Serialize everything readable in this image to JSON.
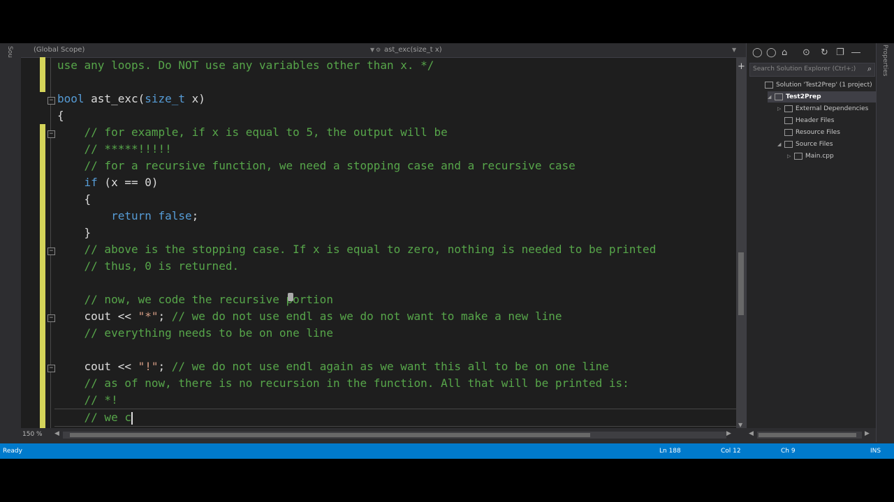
{
  "left_strip": {
    "tab_label": "Sou"
  },
  "navbar": {
    "scope": "(Global Scope)",
    "member": "ast_exc(size_t x)"
  },
  "code_lines": [
    [
      [
        "cm",
        "use any loops. Do NOT use any variables other than x. */"
      ]
    ],
    [],
    [
      [
        "kw",
        "bool"
      ],
      [
        "txt",
        " ast_exc("
      ],
      [
        "kw",
        "size_t"
      ],
      [
        "txt",
        " x)"
      ]
    ],
    [
      [
        "txt",
        "{"
      ]
    ],
    [
      [
        "txt",
        "    "
      ],
      [
        "cm",
        "// for example, if x is equal to 5, the output will be"
      ]
    ],
    [
      [
        "txt",
        "    "
      ],
      [
        "cm",
        "// *****!!!!!"
      ]
    ],
    [
      [
        "txt",
        "    "
      ],
      [
        "cm",
        "// for a recursive function, we need a stopping case and a recursive case"
      ]
    ],
    [
      [
        "txt",
        "    "
      ],
      [
        "kw",
        "if"
      ],
      [
        "txt",
        " (x == 0)"
      ]
    ],
    [
      [
        "txt",
        "    {"
      ]
    ],
    [
      [
        "txt",
        "        "
      ],
      [
        "kw",
        "return"
      ],
      [
        "txt",
        " "
      ],
      [
        "kw",
        "false"
      ],
      [
        "txt",
        ";"
      ]
    ],
    [
      [
        "txt",
        "    }"
      ]
    ],
    [
      [
        "txt",
        "    "
      ],
      [
        "cm",
        "// above is the stopping case. If x is equal to zero, nothing is needed to be printed"
      ]
    ],
    [
      [
        "txt",
        "    "
      ],
      [
        "cm",
        "// thus, 0 is returned."
      ]
    ],
    [],
    [
      [
        "txt",
        "    "
      ],
      [
        "cm",
        "// now, we code the recursive portion"
      ]
    ],
    [
      [
        "txt",
        "    cout << "
      ],
      [
        "str",
        "\"*\""
      ],
      [
        "txt",
        "; "
      ],
      [
        "cm",
        "// we do not use endl as we do not want to make a new line"
      ]
    ],
    [
      [
        "txt",
        "    "
      ],
      [
        "cm",
        "// everything needs to be on one line"
      ]
    ],
    [],
    [
      [
        "txt",
        "    cout << "
      ],
      [
        "str",
        "\"!\""
      ],
      [
        "txt",
        "; "
      ],
      [
        "cm",
        "// we do not use endl again as we want this all to be on one line"
      ]
    ],
    [
      [
        "txt",
        "    "
      ],
      [
        "cm",
        "// as of now, there is no recursion in the function. All that will be printed is:"
      ]
    ],
    [
      [
        "txt",
        "    "
      ],
      [
        "cm",
        "// *!"
      ]
    ],
    [
      [
        "txt",
        "    "
      ],
      [
        "cm",
        "// we c"
      ]
    ]
  ],
  "editor_footer": {
    "zoom": "150 %"
  },
  "solution_explorer": {
    "search_placeholder": "Search Solution Explorer (Ctrl+;)",
    "tree": [
      {
        "label": "Solution 'Test2Prep' (1 project)",
        "indent": 0,
        "expander": "",
        "selected": false
      },
      {
        "label": "Test2Prep",
        "indent": 1,
        "expander": "◢",
        "selected": true
      },
      {
        "label": "External Dependencies",
        "indent": 2,
        "expander": "▷",
        "selected": false
      },
      {
        "label": "Header Files",
        "indent": 2,
        "expander": "",
        "selected": false
      },
      {
        "label": "Resource Files",
        "indent": 2,
        "expander": "",
        "selected": false
      },
      {
        "label": "Source Files",
        "indent": 2,
        "expander": "◢",
        "selected": false
      },
      {
        "label": "Main.cpp",
        "indent": 3,
        "expander": "▷",
        "selected": false
      }
    ]
  },
  "right_strip": {
    "tab_label": "Properties"
  },
  "status": {
    "ready": "Ready",
    "ln": "Ln 188",
    "col": "Col 12",
    "ch": "Ch 9",
    "ins": "INS"
  },
  "colors": {
    "accent": "#007acc",
    "keyword": "#569cd6",
    "comment": "#57a64a",
    "string": "#d69d85"
  }
}
